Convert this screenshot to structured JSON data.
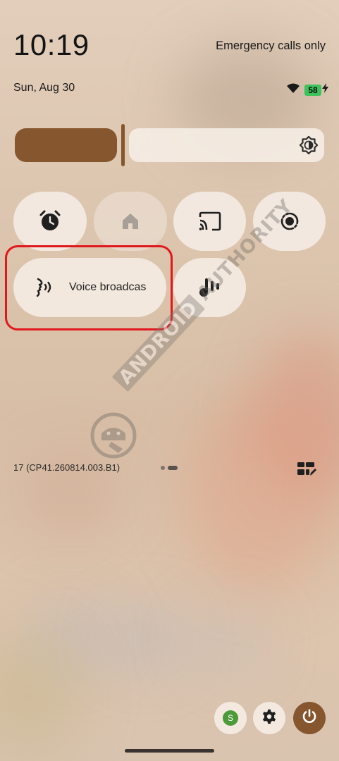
{
  "status": {
    "time": "10:19",
    "carrier_text": "Emergency calls only",
    "date": "Sun, Aug 30",
    "battery_level": "58",
    "icons": [
      "wifi-icon",
      "battery-icon",
      "charging-bolt-icon"
    ]
  },
  "brightness": {
    "level": 0.35,
    "icon": "auto-brightness-icon"
  },
  "tiles": [
    {
      "name": "alarm-tile",
      "icon": "alarm-clock-icon",
      "active": true
    },
    {
      "name": "home-tile",
      "icon": "home-icon",
      "active": false
    },
    {
      "name": "screen-cast-tile",
      "icon": "cast-icon",
      "active": true
    },
    {
      "name": "screen-record-tile",
      "icon": "screen-record-icon",
      "active": true
    },
    {
      "name": "voice-broadcast-tile",
      "icon": "voice-broadcast-icon",
      "label": "Voice broadcas",
      "active": true
    },
    {
      "name": "live-caption-tile",
      "icon": "sound-wave-icon",
      "active": true
    }
  ],
  "watermark": {
    "text_a": "ANDROID",
    "text_b": "AUTHORITY"
  },
  "footer": {
    "build_number": "17 (CP41.260814.003.B1)",
    "pages": 2,
    "current_page": 2,
    "edit_icon": "edit-tiles-icon"
  },
  "bottom": {
    "user_initial": "S",
    "settings_icon": "gear-icon",
    "power_icon": "power-icon"
  },
  "colors": {
    "accent": "#86562e",
    "highlight": "#e0181e",
    "battery": "#3ec25c"
  }
}
